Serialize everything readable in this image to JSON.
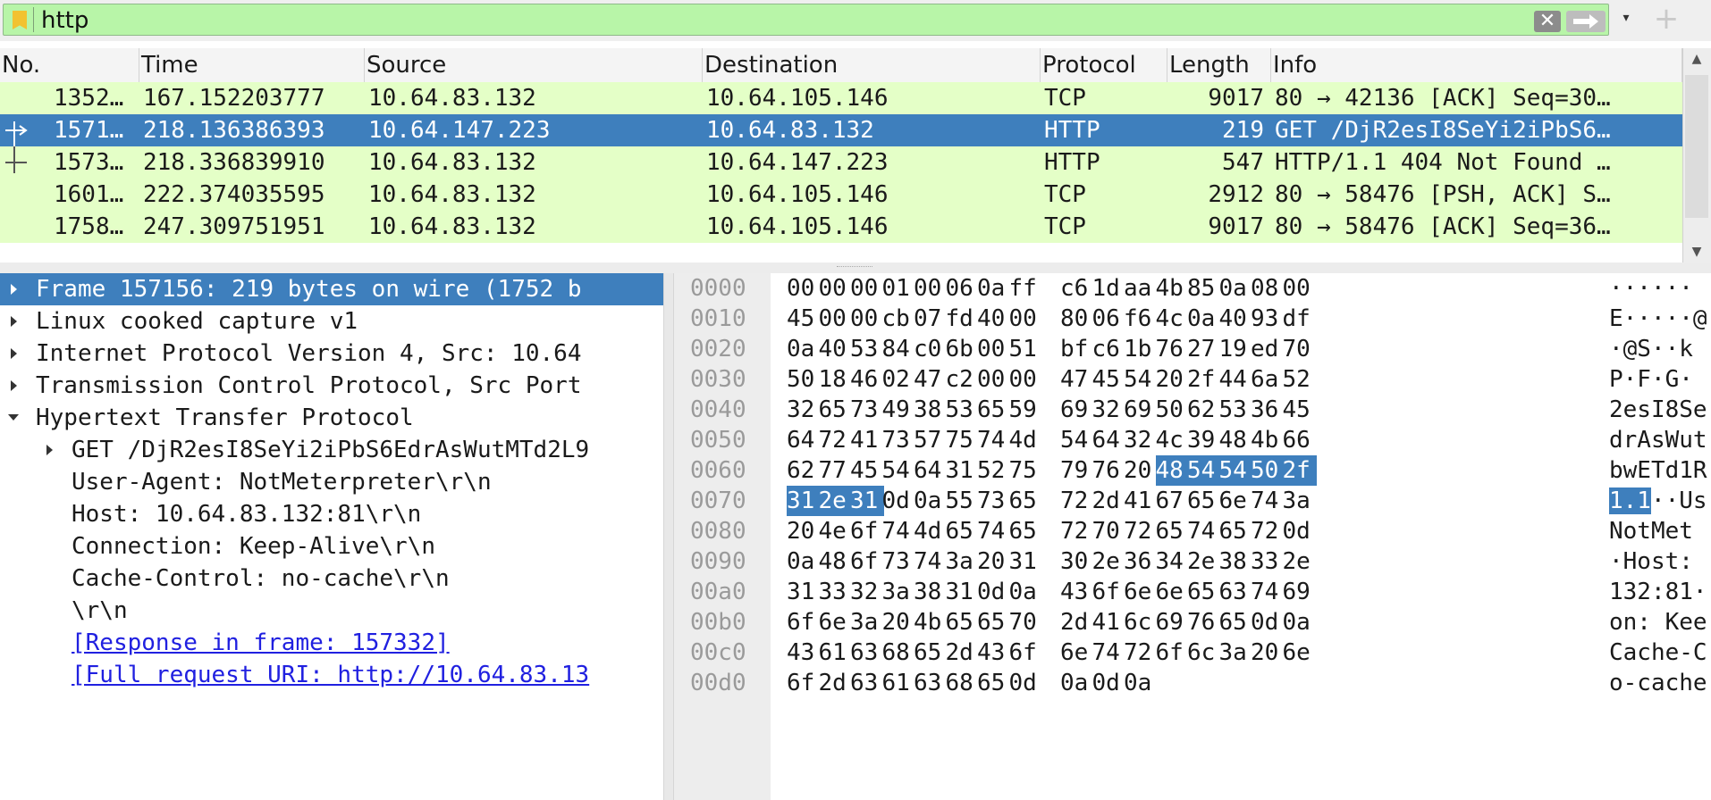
{
  "filter": {
    "text": "http",
    "clear_glyph": "✕",
    "add_glyph": "+",
    "dropdown_glyph": "▾"
  },
  "packet_list": {
    "columns": [
      "No.",
      "Time",
      "Source",
      "Destination",
      "Protocol",
      "Length",
      "Info"
    ],
    "rows": [
      {
        "no": "1352…",
        "time": "167.152203777",
        "source": "10.64.83.132",
        "destination": "10.64.105.146",
        "protocol": "TCP",
        "length": "9017",
        "info": "80 → 42136 [ACK] Seq=30…",
        "selected": false,
        "related": ""
      },
      {
        "no": "1571…",
        "time": "218.136386393",
        "source": "10.64.147.223",
        "destination": "10.64.83.132",
        "protocol": "HTTP",
        "length": "219",
        "info": "GET /DjR2esI8SeYi2iPbS6…",
        "selected": true,
        "related": "request"
      },
      {
        "no": "1573…",
        "time": "218.336839910",
        "source": "10.64.83.132",
        "destination": "10.64.147.223",
        "protocol": "HTTP",
        "length": "547",
        "info": "HTTP/1.1 404 Not Found …",
        "selected": false,
        "related": "response"
      },
      {
        "no": "1601…",
        "time": "222.374035595",
        "source": "10.64.83.132",
        "destination": "10.64.105.146",
        "protocol": "TCP",
        "length": "2912",
        "info": "80 → 58476 [PSH, ACK] S…",
        "selected": false,
        "related": ""
      },
      {
        "no": "1758…",
        "time": "247.309751951",
        "source": "10.64.83.132",
        "destination": "10.64.105.146",
        "protocol": "TCP",
        "length": "9017",
        "info": "80 → 58476 [ACK] Seq=36…",
        "selected": false,
        "related": ""
      }
    ]
  },
  "detail_tree": [
    {
      "text": "Frame 157156: 219 bytes on wire (1752 b",
      "level": 0,
      "arrow": "collapsed",
      "selected": true,
      "link": false
    },
    {
      "text": "Linux cooked capture v1",
      "level": 0,
      "arrow": "collapsed",
      "selected": false,
      "link": false
    },
    {
      "text": "Internet Protocol Version 4, Src: 10.64",
      "level": 0,
      "arrow": "collapsed",
      "selected": false,
      "link": false
    },
    {
      "text": "Transmission Control Protocol, Src Port",
      "level": 0,
      "arrow": "collapsed",
      "selected": false,
      "link": false
    },
    {
      "text": "Hypertext Transfer Protocol",
      "level": 0,
      "arrow": "expanded",
      "selected": false,
      "link": false
    },
    {
      "text": "GET /DjR2esI8SeYi2iPbS6EdrAsWutMTd2L9",
      "level": 1,
      "arrow": "collapsed",
      "selected": false,
      "link": false
    },
    {
      "text": "User-Agent: NotMeterpreter\\r\\n",
      "level": 1,
      "arrow": "none",
      "selected": false,
      "link": false
    },
    {
      "text": "Host: 10.64.83.132:81\\r\\n",
      "level": 1,
      "arrow": "none",
      "selected": false,
      "link": false
    },
    {
      "text": "Connection: Keep-Alive\\r\\n",
      "level": 1,
      "arrow": "none",
      "selected": false,
      "link": false
    },
    {
      "text": "Cache-Control: no-cache\\r\\n",
      "level": 1,
      "arrow": "none",
      "selected": false,
      "link": false
    },
    {
      "text": "\\r\\n",
      "level": 1,
      "arrow": "none",
      "selected": false,
      "link": false
    },
    {
      "text": "[Response in frame: 157332]",
      "level": 1,
      "arrow": "none",
      "selected": false,
      "link": true
    },
    {
      "text": "[Full request URI: http://10.64.83.13",
      "level": 1,
      "arrow": "none",
      "selected": false,
      "link": true
    }
  ],
  "hex_dump": [
    {
      "offset": "0000",
      "bytes": [
        "00",
        "00",
        "00",
        "01",
        "00",
        "06",
        "0a",
        "ff",
        "c6",
        "1d",
        "aa",
        "4b",
        "85",
        "0a",
        "08",
        "00"
      ],
      "ascii": "······",
      "hl": []
    },
    {
      "offset": "0010",
      "bytes": [
        "45",
        "00",
        "00",
        "cb",
        "07",
        "fd",
        "40",
        "00",
        "80",
        "06",
        "f6",
        "4c",
        "0a",
        "40",
        "93",
        "df"
      ],
      "ascii": "E·····@",
      "hl": []
    },
    {
      "offset": "0020",
      "bytes": [
        "0a",
        "40",
        "53",
        "84",
        "c0",
        "6b",
        "00",
        "51",
        "bf",
        "c6",
        "1b",
        "76",
        "27",
        "19",
        "ed",
        "70"
      ],
      "ascii": "·@S··k",
      "hl": []
    },
    {
      "offset": "0030",
      "bytes": [
        "50",
        "18",
        "46",
        "02",
        "47",
        "c2",
        "00",
        "00",
        "47",
        "45",
        "54",
        "20",
        "2f",
        "44",
        "6a",
        "52"
      ],
      "ascii": "P·F·G·",
      "hl": []
    },
    {
      "offset": "0040",
      "bytes": [
        "32",
        "65",
        "73",
        "49",
        "38",
        "53",
        "65",
        "59",
        "69",
        "32",
        "69",
        "50",
        "62",
        "53",
        "36",
        "45"
      ],
      "ascii": "2esI8Se",
      "hl": []
    },
    {
      "offset": "0050",
      "bytes": [
        "64",
        "72",
        "41",
        "73",
        "57",
        "75",
        "74",
        "4d",
        "54",
        "64",
        "32",
        "4c",
        "39",
        "48",
        "4b",
        "66"
      ],
      "ascii": "drAsWut",
      "hl": []
    },
    {
      "offset": "0060",
      "bytes": [
        "62",
        "77",
        "45",
        "54",
        "64",
        "31",
        "52",
        "75",
        "79",
        "76",
        "20",
        "48",
        "54",
        "54",
        "50",
        "2f"
      ],
      "ascii": "bwETd1R",
      "hl": [
        11,
        12,
        13,
        14,
        15
      ]
    },
    {
      "offset": "0070",
      "bytes": [
        "31",
        "2e",
        "31",
        "0d",
        "0a",
        "55",
        "73",
        "65",
        "72",
        "2d",
        "41",
        "67",
        "65",
        "6e",
        "74",
        "3a"
      ],
      "ascii": "1.1··Us",
      "hl": [
        0,
        1,
        2
      ],
      "ascii_hl": 3
    },
    {
      "offset": "0080",
      "bytes": [
        "20",
        "4e",
        "6f",
        "74",
        "4d",
        "65",
        "74",
        "65",
        "72",
        "70",
        "72",
        "65",
        "74",
        "65",
        "72",
        "0d"
      ],
      "ascii": " NotMet",
      "hl": []
    },
    {
      "offset": "0090",
      "bytes": [
        "0a",
        "48",
        "6f",
        "73",
        "74",
        "3a",
        "20",
        "31",
        "30",
        "2e",
        "36",
        "34",
        "2e",
        "38",
        "33",
        "2e"
      ],
      "ascii": "·Host: ",
      "hl": []
    },
    {
      "offset": "00a0",
      "bytes": [
        "31",
        "33",
        "32",
        "3a",
        "38",
        "31",
        "0d",
        "0a",
        "43",
        "6f",
        "6e",
        "6e",
        "65",
        "63",
        "74",
        "69"
      ],
      "ascii": "132:81·",
      "hl": []
    },
    {
      "offset": "00b0",
      "bytes": [
        "6f",
        "6e",
        "3a",
        "20",
        "4b",
        "65",
        "65",
        "70",
        "2d",
        "41",
        "6c",
        "69",
        "76",
        "65",
        "0d",
        "0a"
      ],
      "ascii": "on: Kee",
      "hl": []
    },
    {
      "offset": "00c0",
      "bytes": [
        "43",
        "61",
        "63",
        "68",
        "65",
        "2d",
        "43",
        "6f",
        "6e",
        "74",
        "72",
        "6f",
        "6c",
        "3a",
        "20",
        "6e"
      ],
      "ascii": "Cache-C",
      "hl": []
    },
    {
      "offset": "00d0",
      "bytes": [
        "6f",
        "2d",
        "63",
        "61",
        "63",
        "68",
        "65",
        "0d",
        "0a",
        "0d",
        "0a"
      ],
      "ascii": "o-cache",
      "hl": []
    }
  ],
  "colors": {
    "filter_valid": "#b8f5a8",
    "row_http_tcp": "#e4ffc7",
    "selection": "#3e7fbd",
    "link": "#2020e0"
  }
}
